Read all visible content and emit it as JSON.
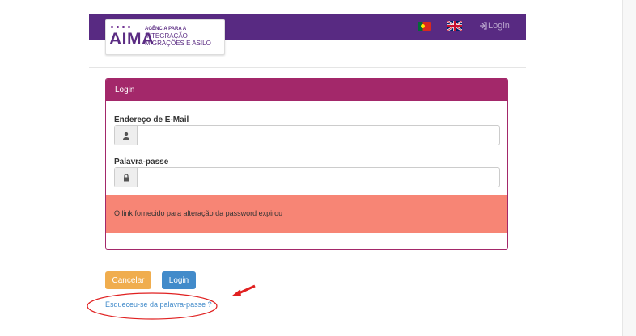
{
  "header": {
    "logo": {
      "mark": "AIMA",
      "line1": "AGÊNCIA PARA A",
      "line2": "INTEGRAÇÃO",
      "line3": "MIGRAÇÕES E ASILO"
    },
    "lang_pt_icon": "flag-portugal",
    "lang_en_icon": "flag-united-kingdom",
    "login_link": "Login",
    "login_icon": "sign-in-icon",
    "color": "#582a82"
  },
  "panel": {
    "title": "Login",
    "color": "#a3286a",
    "email_label": "Endereço de E-Mail",
    "email_value": "",
    "email_icon": "user-icon",
    "password_label": "Palavra-passe",
    "password_value": "",
    "password_icon": "lock-icon",
    "alert_text": "O link fornecido para alteração da password expirou",
    "alert_color": "#f78575"
  },
  "actions": {
    "cancel_label": "Cancelar",
    "cancel_color": "#f0ad4e",
    "login_label": "Login",
    "login_color": "#428bca",
    "forgot_link": "Esqueceu-se da palavra-passe ?"
  },
  "annotation": {
    "ellipse_color": "#e02020",
    "arrow_color": "#e02020"
  }
}
